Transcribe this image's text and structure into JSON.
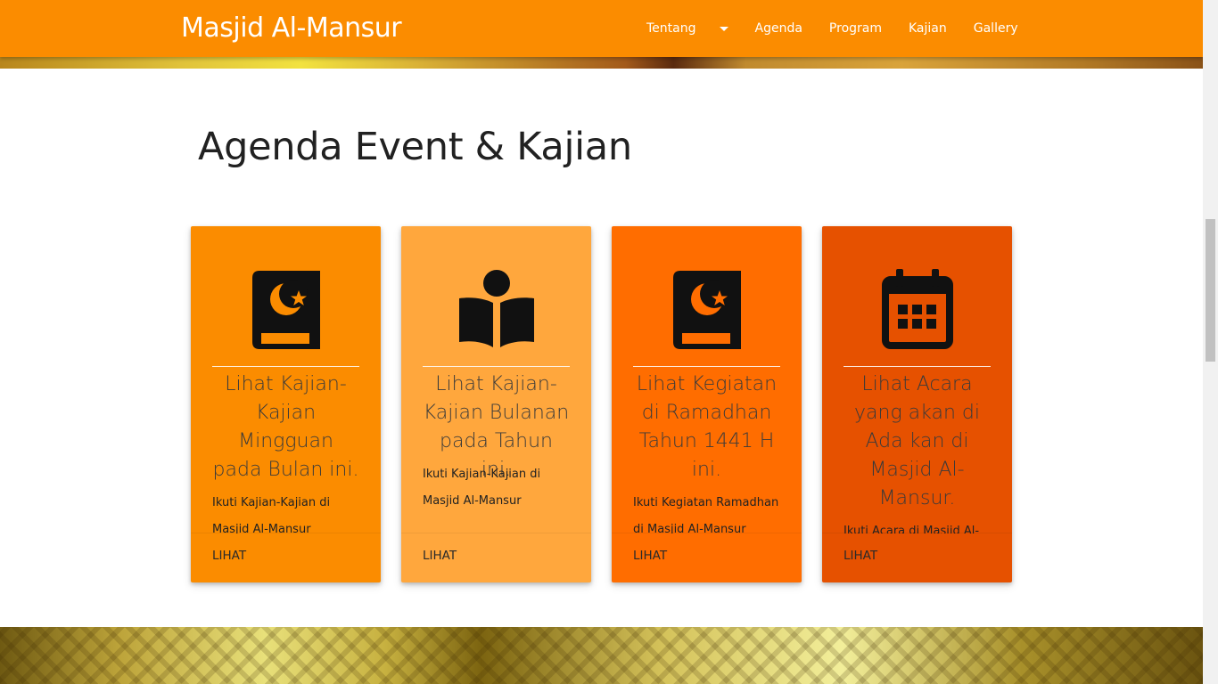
{
  "navbar": {
    "brand": "Masjid Al-Mansur",
    "links": [
      {
        "label": "Tentang",
        "dropdown": true
      },
      {
        "label": "Agenda"
      },
      {
        "label": "Program"
      },
      {
        "label": "Kajian"
      },
      {
        "label": "Gallery"
      }
    ],
    "color": "#fb8c00"
  },
  "section": {
    "title": "Agenda Event & Kajian"
  },
  "cards": [
    {
      "icon": "quran-icon",
      "color": "#fb8c00",
      "title": "Lihat Kajian-Kajian Mingguan pada Bulan ini.",
      "description": "Ikuti Kajian-Kajian di Masjid Al-Mansur",
      "link": "LIHAT"
    },
    {
      "icon": "book-reader-icon",
      "color": "#ffa73d",
      "title": "Lihat Kajian-Kajian Bulanan pada Tahun ini.",
      "description": "Ikuti Kajian-Kajian di Masjid Al-Mansur",
      "link": "LIHAT"
    },
    {
      "icon": "quran-icon",
      "color": "#ff6d00",
      "title": "Lihat Kegiatan di Ramadhan Tahun 1441 H ini.",
      "description": "Ikuti Kegiatan Ramadhan di Masjid Al-Mansur",
      "link": "LIHAT"
    },
    {
      "icon": "calendar-icon",
      "color": "#e65100",
      "title": "Lihat Acara yang akan di Ada kan di Masjid Al-Mansur.",
      "description": "Ikuti Acara di Masjid Al-Mansur",
      "link": "LIHAT"
    }
  ]
}
